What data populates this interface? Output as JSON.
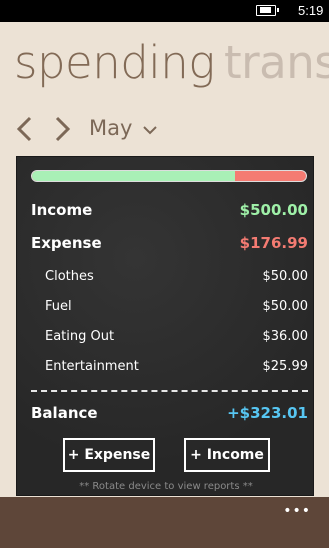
{
  "status_bar": {
    "time": "5:19"
  },
  "pivot": {
    "active_title": "spending",
    "next_title": "trans"
  },
  "month_nav": {
    "prev_icon": "chevron-left-icon",
    "next_icon": "chevron-right-icon",
    "month": "May",
    "dropdown_icon": "chevron-down-icon"
  },
  "summary": {
    "budget_used_fraction": 0.74,
    "income": {
      "label": "Income",
      "amount": "$500.00"
    },
    "expense": {
      "label": "Expense",
      "amount": "$176.99"
    },
    "categories": [
      {
        "label": "Clothes",
        "amount": "$50.00"
      },
      {
        "label": "Fuel",
        "amount": "$50.00"
      },
      {
        "label": "Eating Out",
        "amount": "$36.00"
      },
      {
        "label": "Entertainment",
        "amount": "$25.99"
      }
    ],
    "balance": {
      "label": "Balance",
      "amount": "+$323.01"
    }
  },
  "actions": {
    "add_expense": "+ Expense",
    "add_income": "+ Income"
  },
  "hint": "** Rotate device to view reports **",
  "app_bar": {
    "more": "•••"
  },
  "colors": {
    "background": "#ece2d5",
    "board": "#2b2b2b",
    "income": "#9ff0a8",
    "expense": "#f47b72",
    "balance": "#57c6f2",
    "app_bar": "#5e4639"
  }
}
